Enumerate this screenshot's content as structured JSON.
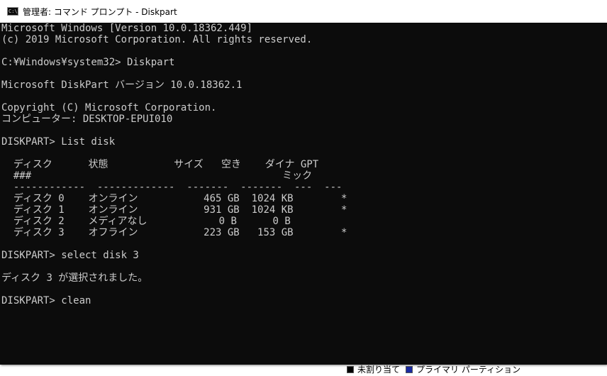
{
  "window": {
    "title": "管理者: コマンド プロンプト - Diskpart",
    "icon": "cmd-icon",
    "colors": {
      "console_bg": "#0c0c0c",
      "console_fg": "#cccccc",
      "titlebar_bg": "#ffffff"
    }
  },
  "console": {
    "lines": [
      "Microsoft Windows [Version 10.0.18362.449]",
      "(c) 2019 Microsoft Corporation. All rights reserved.",
      "",
      "C:¥Windows¥system32> Diskpart",
      "",
      "Microsoft DiskPart バージョン 10.0.18362.1",
      "",
      "Copyright (C) Microsoft Corporation.",
      "コンピューター: DESKTOP-EPUI010",
      "",
      "DISKPART> List disk",
      "",
      "  ディスク      状態           サイズ   空き    ダイナ GPT",
      "  ###                                          ミック",
      "  ------------  -------------  -------  -------  ---  ---",
      "  ディスク 0    オンライン           465 GB  1024 KB        *",
      "  ディスク 1    オンライン           931 GB  1024 KB        *",
      "  ディスク 2    メディアなし            0 B      0 B",
      "  ディスク 3    オフライン           223 GB   153 GB        *",
      "",
      "DISKPART> select disk 3",
      "",
      "ディスク 3 が選択されました。",
      "",
      "DISKPART> clean"
    ]
  },
  "background_window": {
    "legend": [
      {
        "label": "未割り当て",
        "color": "#000000"
      },
      {
        "label": "プライマリ パーティション",
        "color": "#1a2aa0"
      }
    ]
  }
}
